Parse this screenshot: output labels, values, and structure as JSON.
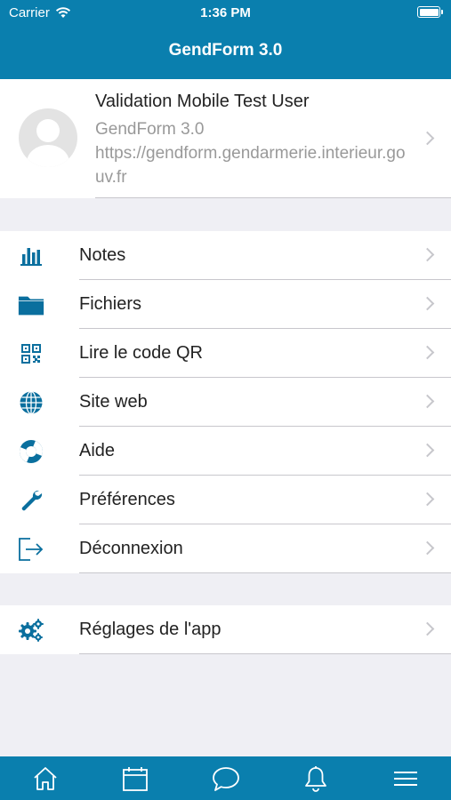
{
  "status_bar": {
    "carrier": "Carrier",
    "time": "1:36 PM"
  },
  "nav": {
    "title": "GendForm 3.0"
  },
  "profile": {
    "name": "Validation Mobile Test User",
    "app": "GendForm 3.0",
    "url": "https://gendform.gendarmerie.interieur.gouv.fr"
  },
  "menu": [
    {
      "label": "Notes",
      "icon": "bar-chart-icon"
    },
    {
      "label": "Fichiers",
      "icon": "folder-icon"
    },
    {
      "label": "Lire le code QR",
      "icon": "qr-code-icon"
    },
    {
      "label": "Site web",
      "icon": "globe-icon"
    },
    {
      "label": "Aide",
      "icon": "lifebuoy-icon"
    },
    {
      "label": "Préférences",
      "icon": "wrench-icon"
    },
    {
      "label": "Déconnexion",
      "icon": "logout-icon"
    }
  ],
  "settings": [
    {
      "label": "Réglages de l'app",
      "icon": "gears-icon"
    }
  ],
  "tabs": [
    {
      "icon": "home-icon"
    },
    {
      "icon": "calendar-icon"
    },
    {
      "icon": "chat-icon"
    },
    {
      "icon": "bell-icon"
    },
    {
      "icon": "menu-icon"
    }
  ],
  "colors": {
    "accent": "#0a7fae",
    "background": "#efeff4",
    "icon": "#0a6f9e"
  }
}
